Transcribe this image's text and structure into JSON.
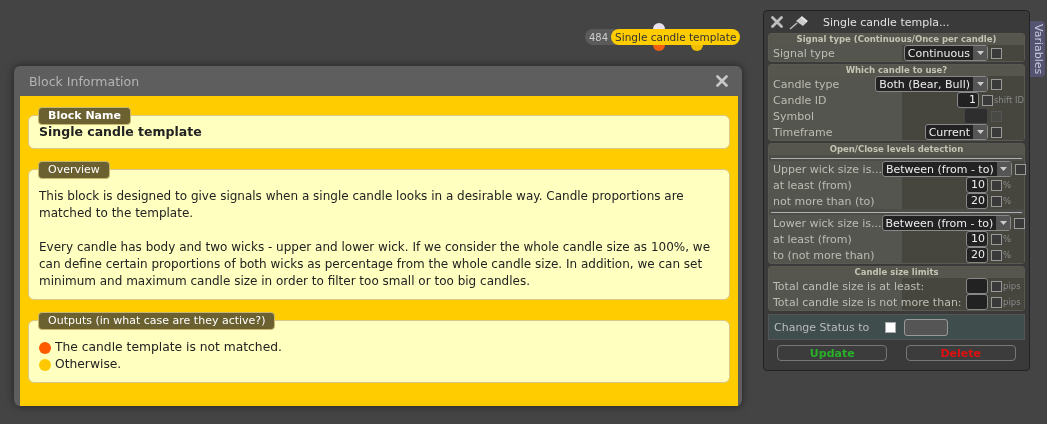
{
  "node": {
    "id": "484",
    "title": "Single candle template",
    "ports": [
      {
        "kind": "input",
        "color": "#e8e0ee"
      },
      {
        "kind": "output",
        "color": "#f06010"
      },
      {
        "kind": "output",
        "color": "#f0c000"
      }
    ]
  },
  "block_info": {
    "title": "Block Information",
    "sections": [
      {
        "kind": "name",
        "title": "Block Name",
        "text": "Single candle template"
      },
      {
        "kind": "text",
        "title": "Overview",
        "paragraphs": [
          "This block is designed to give signals when a single candle looks in a desirable way. Candle proportions are matched to the template.",
          "Every candle has body and two wicks - upper and lower wick. If we consider the whole candle size as 100%, we can define certain proportions of both wicks as percentage from the whole candle size. In addition, we can set minimum and maximum candle size in order to filter too small or too big candles."
        ]
      },
      {
        "kind": "outputs",
        "title": "Outputs (in what case are they active?)",
        "outputs": [
          {
            "text": "The candle template is not matched.",
            "color": "#ff5a00"
          },
          {
            "text": "Otherwise.",
            "color": "#ffc800"
          }
        ]
      }
    ]
  },
  "panel": {
    "title": "Single candle templa...",
    "side_tab": "Variables",
    "groups": [
      {
        "header": "Signal type (Continuous/Once per candle)",
        "rows": [
          {
            "kind": "select",
            "label": "Signal type",
            "value": "Continuous",
            "checked": false
          }
        ]
      },
      {
        "header": "Which candle to use?",
        "rows": [
          {
            "kind": "select",
            "label": "Candle type",
            "value": "Both (Bear, Bull)",
            "checked": false
          },
          {
            "kind": "number",
            "label": "Candle ID",
            "value": "1",
            "checked": false,
            "suffix": "shift ID"
          },
          {
            "kind": "number",
            "label": "Symbol",
            "disabled": true
          },
          {
            "kind": "select",
            "label": "Timeframe",
            "value": "Current",
            "checked": false
          }
        ]
      },
      {
        "header": "Open/Close levels detection",
        "rows": [
          {
            "kind": "select",
            "label": "Upper wick size is...",
            "value": "Between (from - to)",
            "checked": false,
            "separator": true
          },
          {
            "kind": "number",
            "label": "at least (from)",
            "value": "10",
            "checked": false,
            "suffix": "%"
          },
          {
            "kind": "number",
            "label": "not more than (to)",
            "value": "20",
            "checked": false,
            "suffix": "%"
          },
          {
            "kind": "select",
            "label": "Lower wick size is...",
            "value": "Between (from - to)",
            "checked": false,
            "separator": true
          },
          {
            "kind": "number",
            "label": "at least (from)",
            "value": "10",
            "checked": false,
            "suffix": "%"
          },
          {
            "kind": "number",
            "label": "to (not more than)",
            "value": "20",
            "checked": false,
            "suffix": "%"
          }
        ]
      },
      {
        "header": "Candle size limits",
        "rows": [
          {
            "kind": "number",
            "label": "Total candle size is at least:",
            "checked": false,
            "suffix": "pips"
          },
          {
            "kind": "number",
            "label": "Total candle size is not more than:",
            "checked": false,
            "suffix": "pips"
          }
        ]
      }
    ],
    "change_status": {
      "label": "Change Status to",
      "checked": false
    },
    "buttons": [
      {
        "kind": "update",
        "label": "Update"
      },
      {
        "kind": "delete",
        "label": "Delete"
      }
    ]
  }
}
